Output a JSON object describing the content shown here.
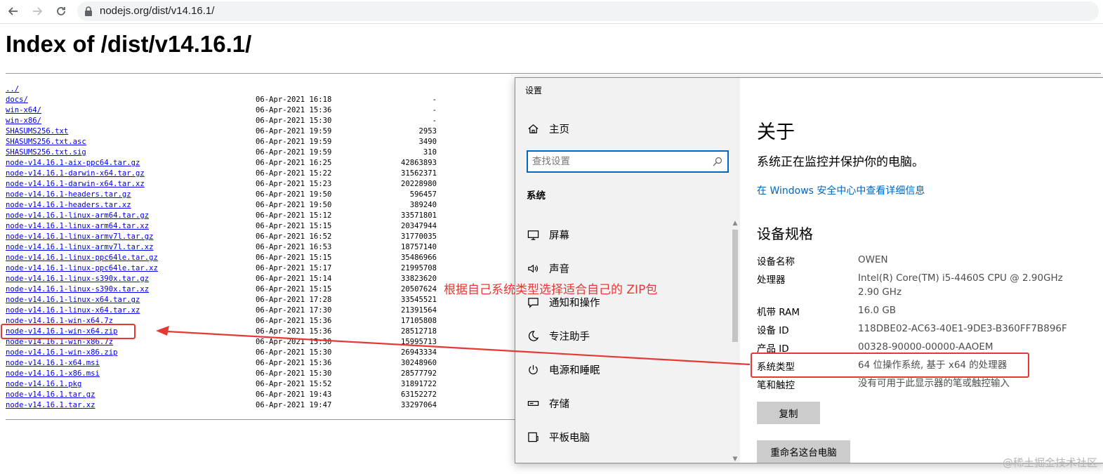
{
  "browser": {
    "url": "nodejs.org/dist/v14.16.1/"
  },
  "index": {
    "title": "Index of /dist/v14.16.1/",
    "rows": [
      {
        "name": "../",
        "date": "",
        "size": ""
      },
      {
        "name": "docs/",
        "date": "06-Apr-2021 16:18",
        "size": "-"
      },
      {
        "name": "win-x64/",
        "date": "06-Apr-2021 15:36",
        "size": "-"
      },
      {
        "name": "win-x86/",
        "date": "06-Apr-2021 15:30",
        "size": "-"
      },
      {
        "name": "SHASUMS256.txt",
        "date": "06-Apr-2021 19:59",
        "size": "2953"
      },
      {
        "name": "SHASUMS256.txt.asc",
        "date": "06-Apr-2021 19:59",
        "size": "3490"
      },
      {
        "name": "SHASUMS256.txt.sig",
        "date": "06-Apr-2021 19:59",
        "size": "310"
      },
      {
        "name": "node-v14.16.1-aix-ppc64.tar.gz",
        "date": "06-Apr-2021 16:25",
        "size": "42863893"
      },
      {
        "name": "node-v14.16.1-darwin-x64.tar.gz",
        "date": "06-Apr-2021 15:22",
        "size": "31562371"
      },
      {
        "name": "node-v14.16.1-darwin-x64.tar.xz",
        "date": "06-Apr-2021 15:23",
        "size": "20228980"
      },
      {
        "name": "node-v14.16.1-headers.tar.gz",
        "date": "06-Apr-2021 19:50",
        "size": "596457"
      },
      {
        "name": "node-v14.16.1-headers.tar.xz",
        "date": "06-Apr-2021 19:50",
        "size": "389240"
      },
      {
        "name": "node-v14.16.1-linux-arm64.tar.gz",
        "date": "06-Apr-2021 15:12",
        "size": "33571801"
      },
      {
        "name": "node-v14.16.1-linux-arm64.tar.xz",
        "date": "06-Apr-2021 15:15",
        "size": "20347944"
      },
      {
        "name": "node-v14.16.1-linux-armv7l.tar.gz",
        "date": "06-Apr-2021 16:52",
        "size": "31770035"
      },
      {
        "name": "node-v14.16.1-linux-armv7l.tar.xz",
        "date": "06-Apr-2021 16:53",
        "size": "18757140"
      },
      {
        "name": "node-v14.16.1-linux-ppc64le.tar.gz",
        "date": "06-Apr-2021 15:15",
        "size": "35486966"
      },
      {
        "name": "node-v14.16.1-linux-ppc64le.tar.xz",
        "date": "06-Apr-2021 15:17",
        "size": "21995708"
      },
      {
        "name": "node-v14.16.1-linux-s390x.tar.gz",
        "date": "06-Apr-2021 15:14",
        "size": "33823620"
      },
      {
        "name": "node-v14.16.1-linux-s390x.tar.xz",
        "date": "06-Apr-2021 15:15",
        "size": "20507624"
      },
      {
        "name": "node-v14.16.1-linux-x64.tar.gz",
        "date": "06-Apr-2021 17:28",
        "size": "33545521"
      },
      {
        "name": "node-v14.16.1-linux-x64.tar.xz",
        "date": "06-Apr-2021 17:30",
        "size": "21391564"
      },
      {
        "name": "node-v14.16.1-win-x64.7z",
        "date": "06-Apr-2021 15:36",
        "size": "17105808"
      },
      {
        "name": "node-v14.16.1-win-x64.zip",
        "date": "06-Apr-2021 15:36",
        "size": "28512718"
      },
      {
        "name": "node-v14.16.1-win-x86.7z",
        "date": "06-Apr-2021 15:30",
        "size": "15995713"
      },
      {
        "name": "node-v14.16.1-win-x86.zip",
        "date": "06-Apr-2021 15:30",
        "size": "26943334"
      },
      {
        "name": "node-v14.16.1-x64.msi",
        "date": "06-Apr-2021 15:36",
        "size": "30248960"
      },
      {
        "name": "node-v14.16.1-x86.msi",
        "date": "06-Apr-2021 15:30",
        "size": "28577792"
      },
      {
        "name": "node-v14.16.1.pkg",
        "date": "06-Apr-2021 15:52",
        "size": "31891722"
      },
      {
        "name": "node-v14.16.1.tar.gz",
        "date": "06-Apr-2021 19:43",
        "size": "63152272"
      },
      {
        "name": "node-v14.16.1.tar.xz",
        "date": "06-Apr-2021 19:47",
        "size": "33297064"
      }
    ]
  },
  "settings": {
    "window_title": "设置",
    "home_label": "主页",
    "search_placeholder": "查找设置",
    "group_label": "系统",
    "nav": [
      {
        "label": "屏幕",
        "icon": "monitor-icon"
      },
      {
        "label": "声音",
        "icon": "speaker-icon"
      },
      {
        "label": "通知和操作",
        "icon": "notification-icon"
      },
      {
        "label": "专注助手",
        "icon": "moon-icon"
      },
      {
        "label": "电源和睡眠",
        "icon": "power-icon"
      },
      {
        "label": "存储",
        "icon": "storage-icon"
      },
      {
        "label": "平板电脑",
        "icon": "tablet-icon"
      }
    ],
    "about": {
      "title": "关于",
      "protect_text": "系统正在监控并保护你的电脑。",
      "security_link": "在 Windows 安全中心中查看详细信息",
      "specs_title": "设备规格",
      "specs": [
        {
          "label": "设备名称",
          "value": "OWEN"
        },
        {
          "label": "处理器",
          "value": "Intel(R) Core(TM) i5-4460S CPU @ 2.90GHz\n2.90 GHz"
        },
        {
          "label": "机带 RAM",
          "value": "16.0 GB"
        },
        {
          "label": "设备 ID",
          "value": "118DBE02-AC63-40E1-9DE3-B360FF7B896F"
        },
        {
          "label": "产品 ID",
          "value": "00328-90000-00000-AAOEM"
        },
        {
          "label": "系统类型",
          "value": "64 位操作系统, 基于 x64 的处理器"
        },
        {
          "label": "笔和触控",
          "value": "没有可用于此显示器的笔或触控输入"
        }
      ],
      "copy_button": "复制",
      "rename_button": "重命名这台电脑"
    }
  },
  "annotation": {
    "text": "根据自己系统类型选择适合自己的 ZIP包",
    "color": "#e53935"
  },
  "watermark": "@稀土掘金技术社区"
}
